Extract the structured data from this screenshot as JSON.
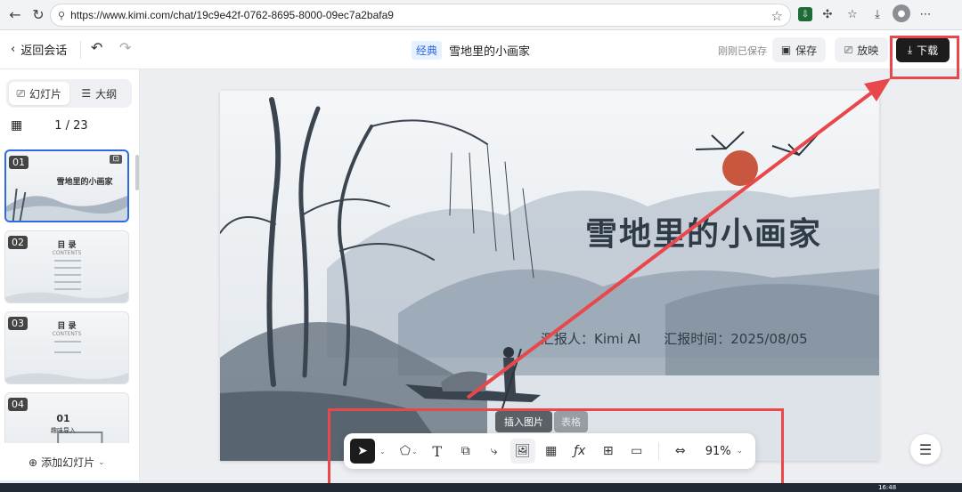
{
  "browser": {
    "url": "https://www.kimi.com/chat/19c9e42f-0762-8695-8000-09ec7a2bafa9"
  },
  "header": {
    "back_label": "返回会话",
    "badge": "经典",
    "doc_title": "雪地里的小画家",
    "saved_status": "刚刚已保存",
    "save_label": "保存",
    "play_label": "放映",
    "download_label": "下载"
  },
  "sidebar": {
    "tabs": [
      {
        "label": "幻灯片",
        "icon": "slides-icon"
      },
      {
        "label": "大纲",
        "icon": "outline-icon"
      }
    ],
    "page_indicator": "1 / 23",
    "thumbnails": [
      {
        "num": "01",
        "title": "雪地里的小画家"
      },
      {
        "num": "02",
        "title": "目 录",
        "sub": "CONTENTS"
      },
      {
        "num": "03",
        "title": "目 录",
        "sub": "CONTENTS"
      },
      {
        "num": "04",
        "title": "01",
        "sub": "趣味导入"
      }
    ],
    "add_slide_label": "添加幻灯片"
  },
  "slide": {
    "title": "雪地里的小画家",
    "reporter": "汇报人：Kimi AI",
    "date": "汇报时间：2025/08/05"
  },
  "toolbar": {
    "tooltip": "插入图片",
    "tooltip_next": "表格",
    "zoom": "91%",
    "tools": [
      "select-icon",
      "shape-icon",
      "text-icon",
      "shape-combine-icon",
      "connector-icon",
      "image-icon",
      "table-icon",
      "formula-icon",
      "component-icon",
      "media-icon",
      "fit-width-icon"
    ]
  },
  "system": {
    "time": "16:48"
  },
  "colors": {
    "accent": "#2d6ae3",
    "annotation": "#e8484b",
    "sun": "#c9573f"
  }
}
